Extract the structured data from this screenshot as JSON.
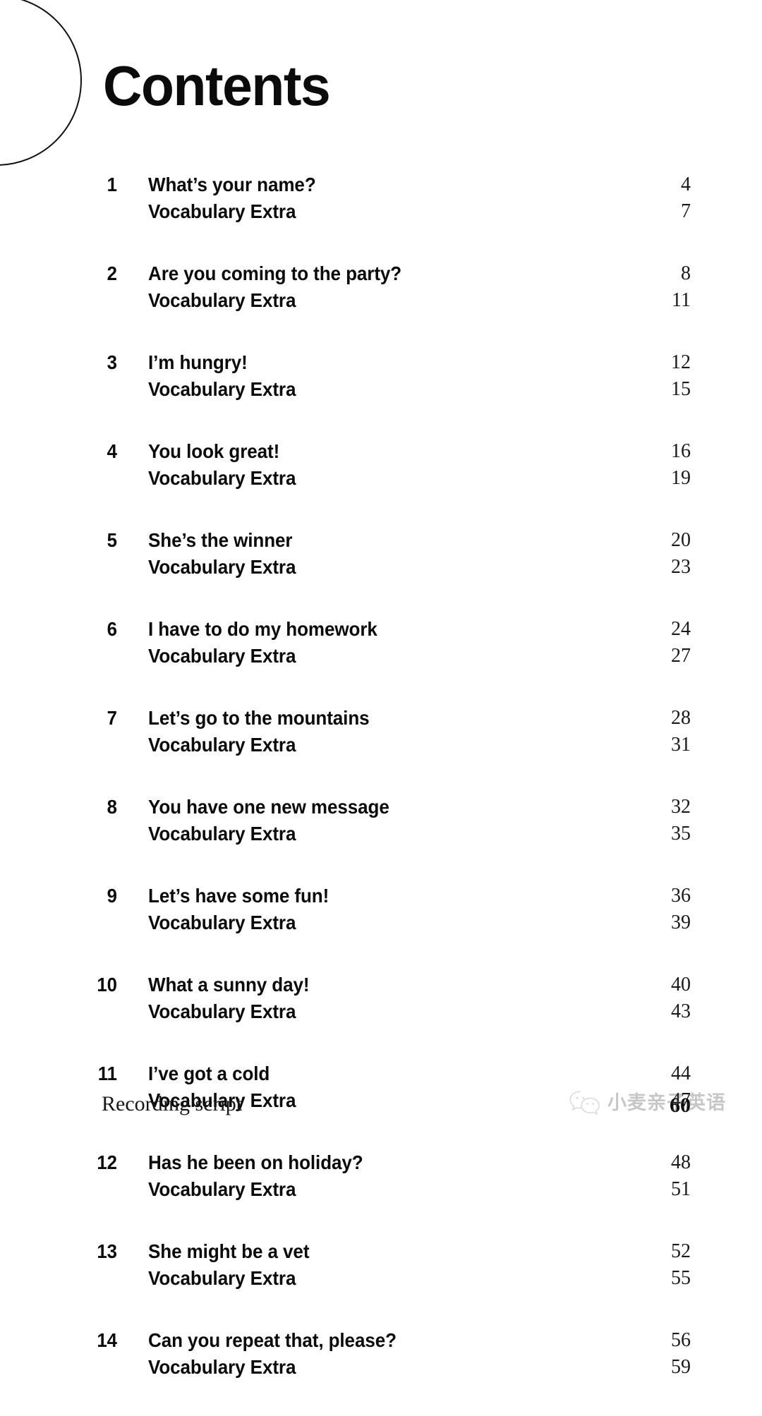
{
  "page": {
    "title": "Contents",
    "background_color": "#ffffff",
    "text_color": "#0b0b0b"
  },
  "decoration": {
    "corner_arc_name": "circle-outline"
  },
  "contents": {
    "entries": [
      {
        "number": "1",
        "title": "What’s your name?",
        "page": "4",
        "sub_title": "Vocabulary Extra",
        "sub_page": "7"
      },
      {
        "number": "2",
        "title": "Are you coming to the party?",
        "page": "8",
        "sub_title": "Vocabulary Extra",
        "sub_page": "11"
      },
      {
        "number": "3",
        "title": "I’m hungry!",
        "page": "12",
        "sub_title": "Vocabulary Extra",
        "sub_page": "15"
      },
      {
        "number": "4",
        "title": "You look great!",
        "page": "16",
        "sub_title": "Vocabulary Extra",
        "sub_page": "19"
      },
      {
        "number": "5",
        "title": "She’s the winner",
        "page": "20",
        "sub_title": "Vocabulary Extra",
        "sub_page": "23"
      },
      {
        "number": "6",
        "title": "I have to do my homework",
        "page": "24",
        "sub_title": "Vocabulary Extra",
        "sub_page": "27"
      },
      {
        "number": "7",
        "title": "Let’s go to the mountains",
        "page": "28",
        "sub_title": "Vocabulary Extra",
        "sub_page": "31"
      },
      {
        "number": "8",
        "title": "You have one new message",
        "page": "32",
        "sub_title": "Vocabulary Extra",
        "sub_page": "35"
      },
      {
        "number": "9",
        "title": "Let’s have some fun!",
        "page": "36",
        "sub_title": "Vocabulary Extra",
        "sub_page": "39"
      },
      {
        "number": "10",
        "title": "What a sunny day!",
        "page": "40",
        "sub_title": "Vocabulary Extra",
        "sub_page": "43"
      },
      {
        "number": "11",
        "title": "I’ve got a cold",
        "page": "44",
        "sub_title": "Vocabulary Extra",
        "sub_page": "47"
      },
      {
        "number": "12",
        "title": "Has he been on holiday?",
        "page": "48",
        "sub_title": "Vocabulary Extra",
        "sub_page": "51"
      },
      {
        "number": "13",
        "title": "She might be a vet",
        "page": "52",
        "sub_title": "Vocabulary Extra",
        "sub_page": "55"
      },
      {
        "number": "14",
        "title": "Can you repeat that, please?",
        "page": "56",
        "sub_title": "Vocabulary Extra",
        "sub_page": "59"
      }
    ]
  },
  "footer": {
    "label": "Recording script",
    "page": "60"
  },
  "watermark": {
    "text": "小麦亲子英语",
    "logo_name": "wechat-logo",
    "color": "#4a4a4a"
  }
}
